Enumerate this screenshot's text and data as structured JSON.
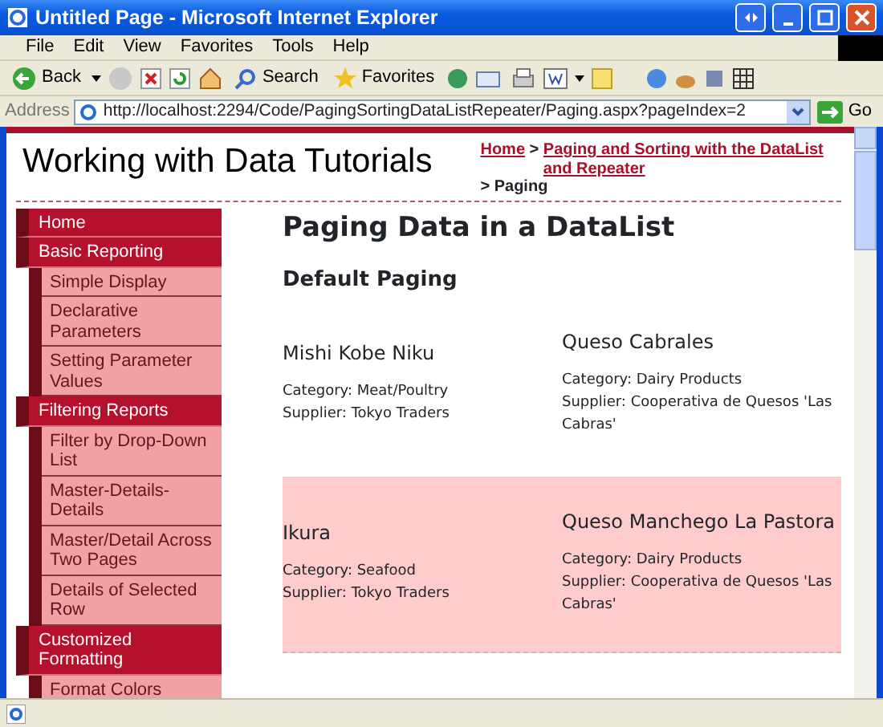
{
  "window": {
    "title": "Untitled Page - Microsoft Internet Explorer"
  },
  "menu": [
    "File",
    "Edit",
    "View",
    "Favorites",
    "Tools",
    "Help"
  ],
  "toolbar": {
    "back": "Back",
    "search": "Search",
    "favorites": "Favorites"
  },
  "address": {
    "label": "Address",
    "url": "http://localhost:2294/Code/PagingSortingDataListRepeater/Paging.aspx?pageIndex=2",
    "go": "Go"
  },
  "site": {
    "title": "Working with Data Tutorials",
    "breadcrumb": [
      {
        "kind": "link",
        "text": "Home"
      },
      {
        "kind": "sep",
        "text": ">"
      },
      {
        "kind": "link",
        "text": "Paging and Sorting with the DataList and Repeater"
      },
      {
        "kind": "sep",
        "text": ">"
      },
      {
        "kind": "current",
        "text": "Paging"
      }
    ]
  },
  "sidebar": {
    "items": [
      {
        "label": "Home"
      },
      {
        "label": "Basic Reporting",
        "children": [
          {
            "label": "Simple Display"
          },
          {
            "label": "Declarative Parameters"
          },
          {
            "label": "Setting Parameter Values"
          }
        ]
      },
      {
        "label": "Filtering Reports",
        "children": [
          {
            "label": "Filter by Drop-Down List"
          },
          {
            "label": "Master-Details-Details"
          },
          {
            "label": "Master/Detail Across Two Pages"
          },
          {
            "label": "Details of Selected Row"
          }
        ]
      },
      {
        "label": "Customized Formatting",
        "children": [
          {
            "label": "Format Colors"
          }
        ]
      }
    ]
  },
  "heading": "Paging Data in a DataList",
  "subheading": "Default Paging",
  "rows": [
    {
      "alternating": false,
      "items": [
        {
          "name": "Mishi Kobe Niku",
          "category": "Category: Meat/Poultry",
          "supplier": "Supplier: Tokyo Traders"
        },
        {
          "name": "Queso Cabrales",
          "category": "Category: Dairy Products",
          "supplier": "Supplier: Cooperativa de Quesos 'Las Cabras'"
        }
      ]
    },
    {
      "alternating": true,
      "items": [
        {
          "name": "Ikura",
          "category": "Category: Seafood",
          "supplier": "Supplier: Tokyo Traders"
        },
        {
          "name": "Queso Manchego La Pastora",
          "category": "Category: Dairy Products",
          "supplier": "Supplier: Cooperativa de Quesos 'Las Cabras'"
        }
      ]
    }
  ]
}
